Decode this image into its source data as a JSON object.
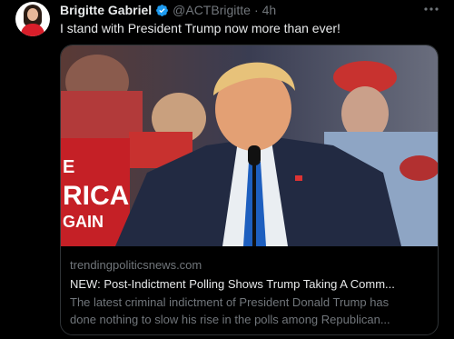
{
  "tweet": {
    "author_name": "Brigitte Gabriel",
    "handle": "@ACTBrigitte",
    "separator": "·",
    "time": "4h",
    "more_icon": "more-horizontal-icon",
    "verified_icon": "verified-badge-icon",
    "text": "I stand with President Trump now more than ever!"
  },
  "card": {
    "domain": "trendingpoliticsnews.com",
    "title": "NEW: Post-Indictment Polling Shows Trump Taking A Comm...",
    "description_line1": "The latest criminal indictment of President Donald Trump has",
    "description_line2": "done nothing to slow his rise in the polls among Republican...",
    "image_sign_text_1": "E",
    "image_sign_text_2": "RICA",
    "image_sign_text_3": "GAIN"
  },
  "colors": {
    "background": "#000000",
    "primary_text": "#e7e9ea",
    "secondary_text": "#71767b",
    "verified_blue": "#1d9bf0",
    "border": "#2f3336"
  }
}
